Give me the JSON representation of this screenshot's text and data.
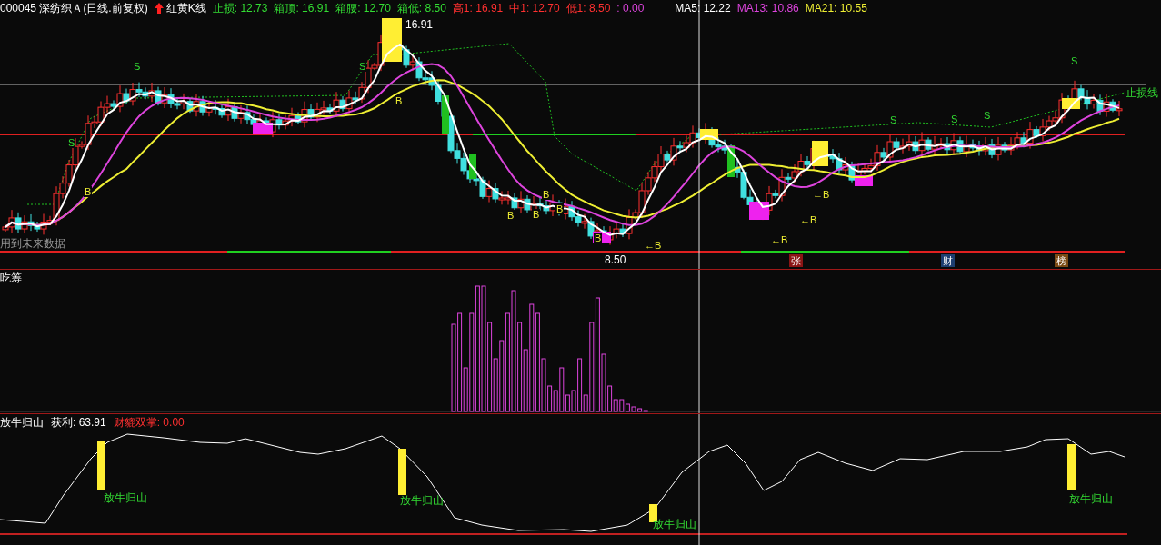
{
  "header": {
    "security": "000045 深纺织Ａ(日线.前复权)",
    "indicator": "红黄K线",
    "readings": [
      {
        "text": "止损: 12.73",
        "color": "#33dd33"
      },
      {
        "text": "箱顶: 16.91",
        "color": "#33dd33"
      },
      {
        "text": "箱腰: 12.70",
        "color": "#33dd33"
      },
      {
        "text": "箱低: 8.50",
        "color": "#33dd33"
      },
      {
        "text": "高1: 16.91",
        "color": "#ff3030"
      },
      {
        "text": "中1: 12.70",
        "color": "#ff3030"
      },
      {
        "text": "低1: 8.50",
        "color": "#ff3030"
      },
      {
        "text": ": 0.00",
        "color": "#dd44dd"
      }
    ],
    "averages": [
      {
        "text": "MA5: 12.22",
        "color": "#ffffff"
      },
      {
        "text": "MA13: 10.86",
        "color": "#dd44dd"
      },
      {
        "text": "MA21: 10.55",
        "color": "#eeee33"
      }
    ]
  },
  "main_chart": {
    "price_labels": [
      "16.91",
      "8.50"
    ],
    "markers": [
      {
        "text": "S",
        "kind": "sell"
      },
      {
        "text": "S",
        "kind": "sell"
      },
      {
        "text": "S",
        "kind": "sell"
      },
      {
        "text": "S",
        "kind": "sell"
      },
      {
        "text": "S",
        "kind": "sell"
      },
      {
        "text": "S",
        "kind": "sell"
      },
      {
        "text": "S",
        "kind": "sell"
      },
      {
        "text": "B",
        "kind": "buy"
      },
      {
        "text": "B",
        "kind": "buy"
      },
      {
        "text": "B",
        "kind": "buy"
      },
      {
        "text": "B",
        "kind": "buy"
      },
      {
        "text": "B",
        "kind": "buy"
      },
      {
        "text": "B",
        "kind": "buy"
      },
      {
        "text": "←B",
        "kind": "buy"
      },
      {
        "text": "B",
        "kind": "buy"
      },
      {
        "text": "←B",
        "kind": "buy"
      },
      {
        "text": "←B",
        "kind": "buy"
      },
      {
        "text": "←B",
        "kind": "buy"
      }
    ],
    "stop_line_label": "止损线",
    "warning": "用到未来数据",
    "badges": [
      {
        "text": "张",
        "color": "#8b1414"
      },
      {
        "text": "财",
        "color": "#1c3e70"
      },
      {
        "text": "榜",
        "color": "#7a4a14"
      }
    ]
  },
  "chip_panel": {
    "title": "吃筹"
  },
  "bottom_panel": {
    "title": "放牛归山",
    "profit": "获利: 63.91",
    "signal": "财貔双掌: 0.00",
    "signal_labels": [
      "放牛归山",
      "放牛归山",
      "放牛归山",
      "放牛归山"
    ]
  }
}
